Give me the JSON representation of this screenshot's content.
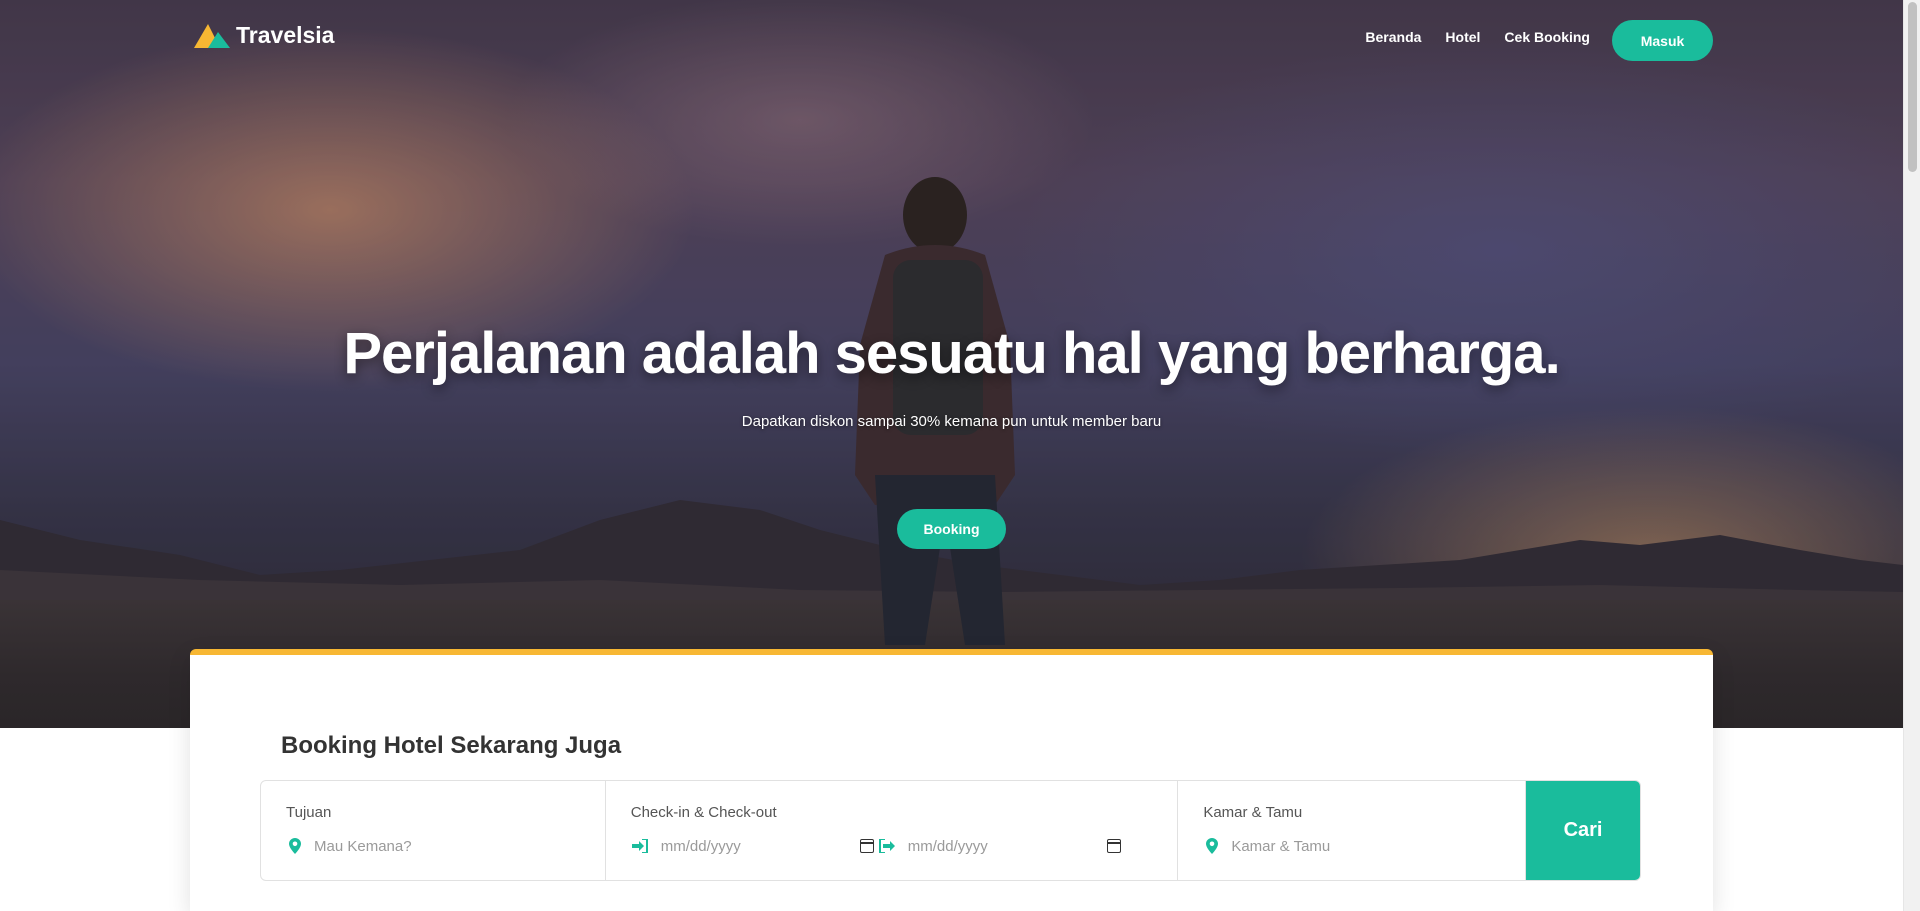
{
  "brand": {
    "name": "Travelsia",
    "logo_icon": "triangle-logo-icon"
  },
  "nav": {
    "links": [
      "Beranda",
      "Hotel",
      "Cek Booking"
    ],
    "login_label": "Masuk"
  },
  "hero": {
    "title": "Perjalanan adalah sesuatu hal yang berharga.",
    "subtitle": "Dapatkan diskon sampai 30% kemana pun untuk member baru",
    "cta_label": "Booking"
  },
  "booking": {
    "title": "Booking Hotel Sekarang Juga",
    "destination": {
      "label": "Tujuan",
      "placeholder": "Mau Kemana?",
      "icon": "map-marker-icon"
    },
    "dates": {
      "label": "Check-in & Check-out",
      "checkin_placeholder": "mm/dd/yyyy",
      "checkout_placeholder": "mm/dd/yyyy",
      "checkin_icon": "sign-in-icon",
      "checkout_icon": "sign-out-icon"
    },
    "guests": {
      "label": "Kamar & Tamu",
      "placeholder": "Kamar & Tamu",
      "icon": "map-marker-icon"
    },
    "search_label": "Cari"
  },
  "colors": {
    "accent": "#1abc9c",
    "highlight": "#f7b733",
    "logo_yellow": "#f7b733",
    "logo_teal": "#1abc9c"
  }
}
